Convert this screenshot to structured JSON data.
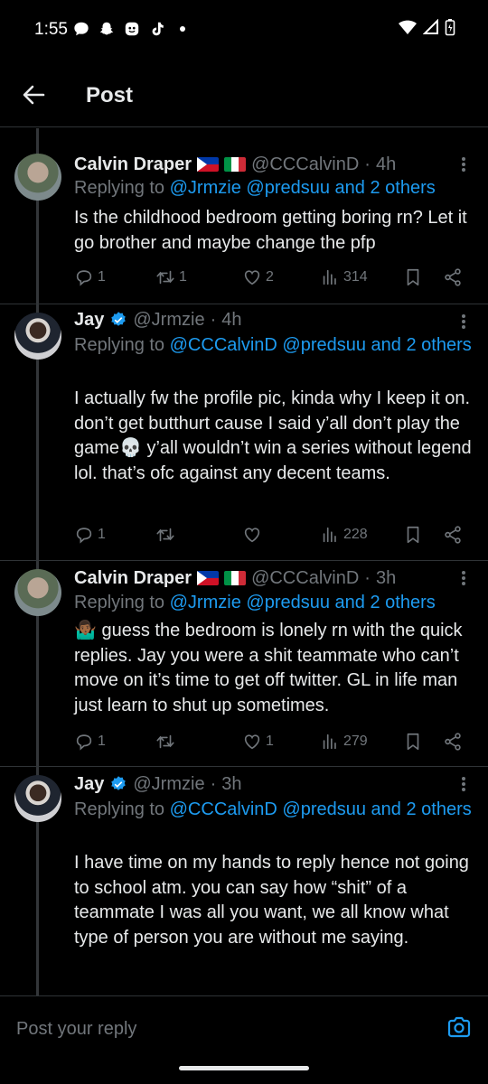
{
  "status_bar": {
    "time": "1:55",
    "notif_icons": [
      "message-icon",
      "snapchat-icon",
      "ghost-app-icon",
      "tiktok-icon",
      "dot-icon"
    ],
    "right_icons": [
      "wifi-icon",
      "signal-icon",
      "battery-icon"
    ]
  },
  "header": {
    "title": "Post"
  },
  "tweets": [
    {
      "name": "Calvin Draper",
      "flags": [
        "flag-philippines",
        "flag-italy"
      ],
      "handle": "@CCCalvinD",
      "dot": "·",
      "time": "4h",
      "replying_prefix": "Replying to",
      "mentions": [
        "@Jrmzie",
        "@predsuu",
        "and 2 others"
      ],
      "text": "Is the childhood bedroom getting boring rn? Let it go brother and maybe change the pfp",
      "stats": {
        "replies": "1",
        "reposts": "1",
        "likes": "2",
        "views": "314"
      }
    },
    {
      "name": "Jay",
      "verified": true,
      "handle": "@Jrmzie",
      "dot": "·",
      "time": "4h",
      "replying_prefix": "Replying to",
      "mentions": [
        "@CCCalvinD",
        "@predsuu",
        "and 2 others"
      ],
      "text": "I actually fw the profile pic, kinda why I keep it on. don’t get butthurt cause I said y’all don’t play the game💀 y’all wouldn’t win a series without legend lol. that’s ofc against any decent teams.",
      "stats": {
        "replies": "1",
        "reposts": "",
        "likes": "",
        "views": "228"
      }
    },
    {
      "name": "Calvin Draper",
      "flags": [
        "flag-philippines",
        "flag-italy"
      ],
      "handle": "@CCCalvinD",
      "dot": "·",
      "time": "3h",
      "replying_prefix": "Replying to",
      "mentions": [
        "@Jrmzie",
        "@predsuu",
        "and 2 others"
      ],
      "text": "🤷🏾‍♂️ guess the bedroom is lonely rn with the quick replies. Jay you were a shit teammate who can’t move on it’s time to get off twitter. GL in life man just learn to shut up sometimes.",
      "stats": {
        "replies": "1",
        "reposts": "",
        "likes": "1",
        "views": "279"
      }
    },
    {
      "name": "Jay",
      "verified": true,
      "handle": "@Jrmzie",
      "dot": "·",
      "time": "3h",
      "replying_prefix": "Replying to",
      "mentions": [
        "@CCCalvinD",
        "@predsuu",
        "and 2 others"
      ],
      "text": "I have time on my hands to reply hence not going to school atm. you can say how “shit” of a teammate I was all you want, we all know what type of person you are without me saying."
    }
  ],
  "reply_bar": {
    "placeholder": "Post your reply"
  },
  "colors": {
    "background": "#000000",
    "text": "#e7e9ea",
    "muted": "#71767b",
    "accent": "#1d9bf0",
    "border": "#2f3336"
  }
}
